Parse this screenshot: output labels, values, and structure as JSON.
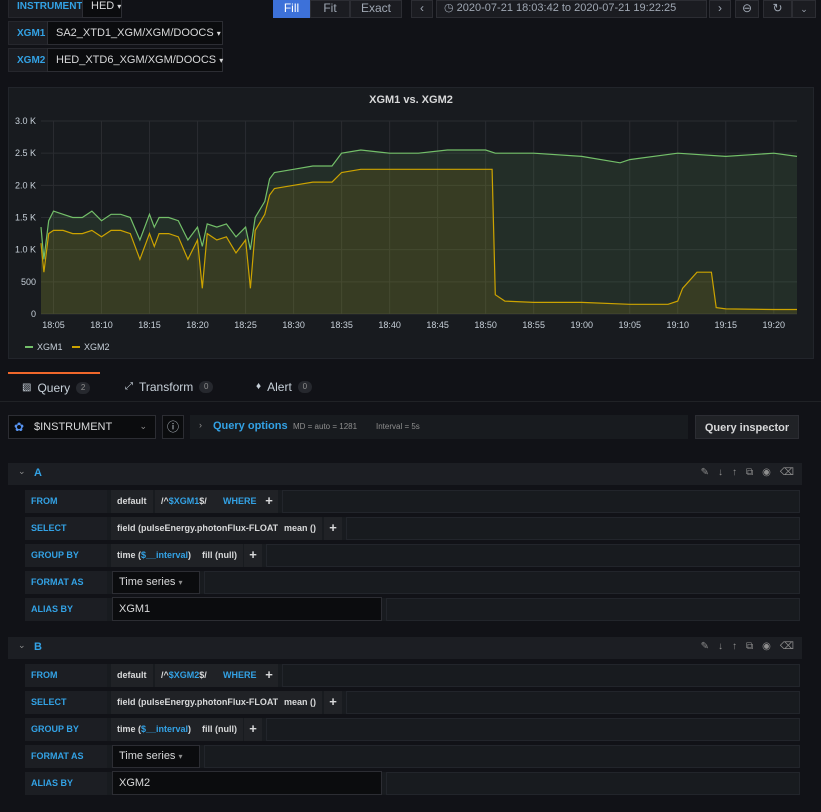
{
  "toolbar": {
    "instrument_label": "INSTRUMENT",
    "instrument_value": "HED",
    "xgm1_label": "XGM1",
    "xgm1_value": "SA2_XTD1_XGM/XGM/DOOCS",
    "xgm2_label": "XGM2",
    "xgm2_value": "HED_XTD6_XGM/XGM/DOOCS",
    "fill_label": "Fill",
    "fit_label": "Fit",
    "exact_label": "Exact",
    "time_range": "2020-07-21 18:03:42 to 2020-07-21 19:22:25"
  },
  "panel": {
    "title": "XGM1 vs. XGM2"
  },
  "chart_data": {
    "type": "area",
    "title": "XGM1 vs. XGM2",
    "x_ticks": [
      "18:05",
      "18:10",
      "18:15",
      "18:20",
      "18:25",
      "18:30",
      "18:35",
      "18:40",
      "18:45",
      "18:50",
      "18:55",
      "19:00",
      "19:05",
      "19:10",
      "19:15",
      "19:20"
    ],
    "y_ticks": [
      "0",
      "500",
      "1.0 K",
      "1.5 K",
      "2.0 K",
      "2.5 K",
      "3.0 K"
    ],
    "ylim": [
      0,
      3000
    ],
    "xlim": [
      "18:03:42",
      "19:22:25"
    ],
    "grid": true,
    "legend": "bottom-left",
    "series": [
      {
        "name": "XGM1",
        "color": "#73bf69",
        "x": [
          "18:03:42",
          "18:04:00",
          "18:04:30",
          "18:05:00",
          "18:06:00",
          "18:07:00",
          "18:08:00",
          "18:09:00",
          "18:10:00",
          "18:11:00",
          "18:12:00",
          "18:13:00",
          "18:14:00",
          "18:15:00",
          "18:15:30",
          "18:16:00",
          "18:17:00",
          "18:18:00",
          "18:19:00",
          "18:20:00",
          "18:20:30",
          "18:21:00",
          "18:22:00",
          "18:23:00",
          "18:24:00",
          "18:25:00",
          "18:25:30",
          "18:26:00",
          "18:27:00",
          "18:27:30",
          "18:28:00",
          "18:30:00",
          "18:32:00",
          "18:34:00",
          "18:35:00",
          "18:37:00",
          "18:40:00",
          "18:43:00",
          "18:46:00",
          "18:48:00",
          "18:50:00",
          "18:51:00",
          "18:55:00",
          "19:00:00",
          "19:04:00",
          "19:05:00",
          "19:10:00",
          "19:15:00",
          "19:20:00",
          "19:22:25"
        ],
        "values": [
          1350,
          850,
          1450,
          1600,
          1550,
          1500,
          1500,
          1600,
          1450,
          1550,
          1550,
          1500,
          1150,
          1550,
          1350,
          1500,
          1500,
          1450,
          1150,
          1350,
          1050,
          1400,
          1350,
          1400,
          1200,
          1350,
          1000,
          1500,
          1750,
          2100,
          2200,
          2250,
          2300,
          2300,
          2500,
          2550,
          2500,
          2500,
          2550,
          2550,
          2550,
          2500,
          2500,
          2450,
          2350,
          2400,
          2500,
          2450,
          2500,
          2450
        ]
      },
      {
        "name": "XGM2",
        "color": "#cca300",
        "x": [
          "18:03:42",
          "18:04:00",
          "18:04:30",
          "18:05:00",
          "18:06:00",
          "18:07:00",
          "18:08:00",
          "18:09:00",
          "18:10:00",
          "18:11:00",
          "18:12:00",
          "18:13:00",
          "18:14:00",
          "18:15:00",
          "18:15:30",
          "18:16:00",
          "18:17:00",
          "18:18:00",
          "18:19:00",
          "18:20:00",
          "18:20:30",
          "18:21:00",
          "18:22:00",
          "18:23:00",
          "18:24:00",
          "18:25:00",
          "18:25:30",
          "18:26:00",
          "18:27:00",
          "18:27:30",
          "18:28:00",
          "18:30:00",
          "18:32:00",
          "18:34:00",
          "18:35:00",
          "18:37:00",
          "18:40:00",
          "18:43:00",
          "18:46:00",
          "18:48:00",
          "18:50:00",
          "18:50:40",
          "18:51:00",
          "18:52:00",
          "18:55:00",
          "19:00:00",
          "19:05:00",
          "19:09:00",
          "19:10:00",
          "19:10:30",
          "19:12:00",
          "19:13:30",
          "19:14:00",
          "19:15:00",
          "19:20:00",
          "19:22:25"
        ],
        "values": [
          1100,
          650,
          1250,
          1300,
          1300,
          1250,
          1250,
          1300,
          1200,
          1300,
          1300,
          1250,
          850,
          1250,
          1050,
          1250,
          1250,
          1200,
          850,
          1150,
          400,
          1250,
          1150,
          1200,
          950,
          1150,
          400,
          1300,
          1550,
          1850,
          1950,
          2000,
          2050,
          2050,
          2200,
          2250,
          2250,
          2250,
          2250,
          2250,
          2250,
          2250,
          300,
          200,
          180,
          180,
          150,
          150,
          200,
          400,
          650,
          650,
          100,
          80,
          70,
          70
        ]
      }
    ]
  },
  "tabs": [
    {
      "label": "Query",
      "count": "2"
    },
    {
      "label": "Transform",
      "count": "0"
    },
    {
      "label": "Alert",
      "count": "0"
    }
  ],
  "query_toolbar": {
    "datasource": "$INSTRUMENT",
    "options_label": "Query options",
    "options_md": "MD = auto = 1281",
    "options_interval": "Interval = 5s",
    "inspector_label": "Query inspector"
  },
  "queries": [
    {
      "letter": "A",
      "from_label": "FROM",
      "from_db": "default",
      "from_measure_pre": "/^",
      "from_measure_var": "$XGM1",
      "from_measure_post": "$/",
      "where_label": "WHERE",
      "select_label": "SELECT",
      "select_field": "field (pulseEnergy.photonFlux-FLOAT)",
      "select_fn": "mean ()",
      "group_label": "GROUP BY",
      "group_time_pre": "time (",
      "group_time_var": "$__interval",
      "group_time_post": ")",
      "group_fill": "fill (null)",
      "format_label": "FORMAT AS",
      "format_value": "Time series",
      "alias_label": "ALIAS BY",
      "alias_value": "XGM1"
    },
    {
      "letter": "B",
      "from_label": "FROM",
      "from_db": "default",
      "from_measure_pre": "/^",
      "from_measure_var": "$XGM2",
      "from_measure_post": "$/",
      "where_label": "WHERE",
      "select_label": "SELECT",
      "select_field": "field (pulseEnergy.photonFlux-FLOAT)",
      "select_fn": "mean ()",
      "group_label": "GROUP BY",
      "group_time_pre": "time (",
      "group_time_var": "$__interval",
      "group_time_post": ")",
      "group_fill": "fill (null)",
      "format_label": "FORMAT AS",
      "format_value": "Time series",
      "alias_label": "ALIAS BY",
      "alias_value": "XGM2"
    }
  ],
  "colors": {
    "accent": "#33a2e5",
    "active_tab": "#f0672b",
    "fill_active": "#3d71d9"
  }
}
